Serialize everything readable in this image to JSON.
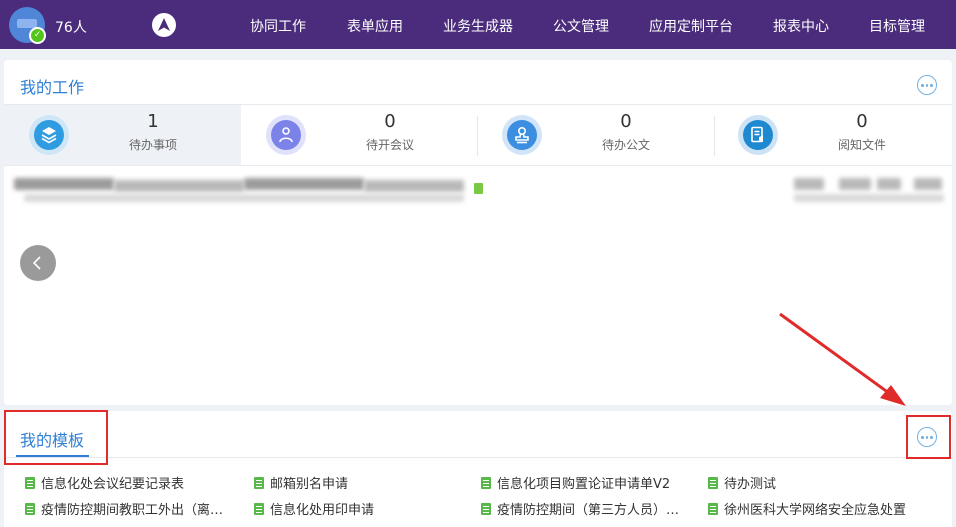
{
  "header": {
    "user_count": "76人",
    "nav_items": [
      "协同工作",
      "表单应用",
      "业务生成器",
      "公文管理",
      "应用定制平台",
      "报表中心",
      "目标管理"
    ]
  },
  "work": {
    "title": "我的工作",
    "stats": [
      {
        "count": "1",
        "label": "待办事项",
        "icon": "layers-icon",
        "color": "#2f9be0"
      },
      {
        "count": "0",
        "label": "待开会议",
        "icon": "people-icon",
        "color": "#7b82e8"
      },
      {
        "count": "0",
        "label": "待办公文",
        "icon": "stamp-icon",
        "color": "#3c8fe0"
      },
      {
        "count": "0",
        "label": "阅知文件",
        "icon": "document-icon",
        "color": "#1e88d0"
      }
    ]
  },
  "templates": {
    "title": "我的模板",
    "items": [
      "信息化处会议纪要记录表",
      "邮箱别名申请",
      "信息化项目购置论证申请单V2",
      "待办测试",
      "疫情防控期间教职工外出（离…",
      "信息化处用印申请",
      "疫情防控期间（第三方人员）…",
      "徐州医科大学网络安全应急处置"
    ]
  },
  "colors": {
    "nav_bg": "#4b2c7c",
    "accent": "#2f7fd4",
    "annotation_red": "#e02b2b"
  }
}
